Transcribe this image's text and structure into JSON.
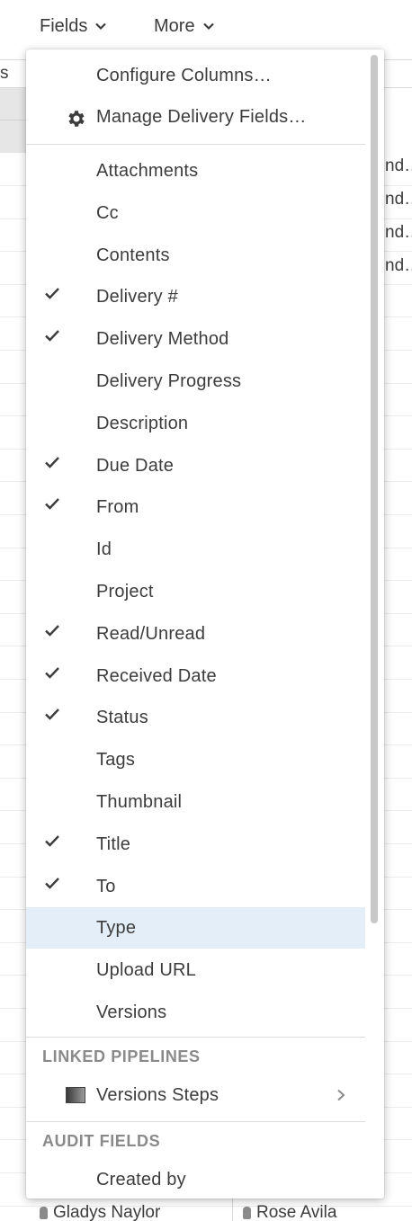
{
  "toolbar": {
    "fields_label": "Fields",
    "more_label": "More"
  },
  "grid": {
    "header_partial": "s",
    "right_truncated": [
      "nd…",
      "nd…",
      "nd…",
      "nd…"
    ],
    "bottom_row": {
      "cell_1": "Gladys Naylor",
      "cell_2": "Rose Avila"
    }
  },
  "menu": {
    "actions": [
      {
        "label": "Configure Columns…",
        "icon": null
      },
      {
        "label": "Manage Delivery Fields…",
        "icon": "gear-icon"
      }
    ],
    "fields": [
      {
        "label": "Attachments",
        "checked": false
      },
      {
        "label": "Cc",
        "checked": false
      },
      {
        "label": "Contents",
        "checked": false
      },
      {
        "label": "Delivery #",
        "checked": true
      },
      {
        "label": "Delivery Method",
        "checked": true
      },
      {
        "label": "Delivery Progress",
        "checked": false
      },
      {
        "label": "Description",
        "checked": false
      },
      {
        "label": "Due Date",
        "checked": true
      },
      {
        "label": "From",
        "checked": true
      },
      {
        "label": "Id",
        "checked": false
      },
      {
        "label": "Project",
        "checked": false
      },
      {
        "label": "Read/Unread",
        "checked": true
      },
      {
        "label": "Received Date",
        "checked": true
      },
      {
        "label": "Status",
        "checked": true
      },
      {
        "label": "Tags",
        "checked": false
      },
      {
        "label": "Thumbnail",
        "checked": false
      },
      {
        "label": "Title",
        "checked": true
      },
      {
        "label": "To",
        "checked": true
      },
      {
        "label": "Type",
        "checked": false,
        "highlighted": true
      },
      {
        "label": "Upload URL",
        "checked": false
      },
      {
        "label": "Versions",
        "checked": false
      }
    ],
    "linked_pipelines": {
      "heading": "LINKED PIPELINES",
      "items": [
        {
          "label": "Versions Steps",
          "icon": "pipeline-step-icon",
          "has_submenu": true
        }
      ]
    },
    "audit_fields": {
      "heading": "AUDIT FIELDS",
      "items": [
        {
          "label": "Created by"
        }
      ]
    }
  },
  "colors": {
    "highlight": "#e3eef8",
    "text": "#3c3c3c",
    "section_heading": "#8a8a8a"
  }
}
